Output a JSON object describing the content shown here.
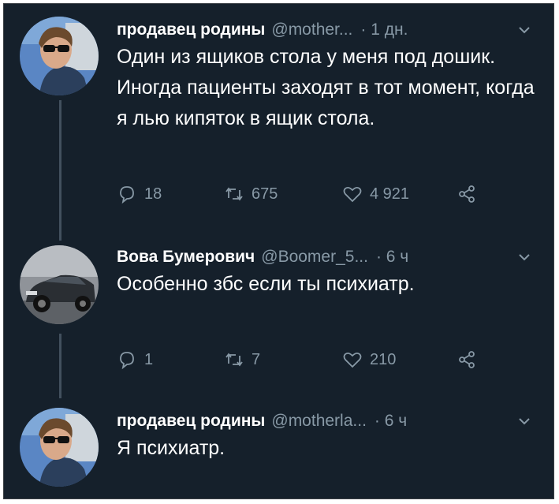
{
  "tweets": [
    {
      "name": "продавец родины",
      "handle": "@mother...",
      "time": "· 1 дн.",
      "text": "Один из ящиков стола у меня под дошик. Иногда пациенты заходят в тот момент, когда я лью кипяток в ящик стола.",
      "replies": "18",
      "retweets": "675",
      "likes": "4 921"
    },
    {
      "name": "Вова Бумерович",
      "handle": "@Boomer_5...",
      "time": "· 6 ч",
      "text": "Особенно збс если ты психиатр.",
      "replies": "1",
      "retweets": "7",
      "likes": "210"
    },
    {
      "name": "продавец родины",
      "handle": "@motherla...",
      "time": "· 6 ч",
      "text": "Я психиатр."
    }
  ],
  "colors": {
    "background": "#15202b",
    "text": "#ffffff",
    "muted": "#8899a6",
    "thread_line": "#42505e"
  },
  "icons": {
    "reply": "reply-icon",
    "retweet": "retweet-icon",
    "like": "heart-icon",
    "share": "share-icon",
    "menu": "chevron-down-icon"
  }
}
